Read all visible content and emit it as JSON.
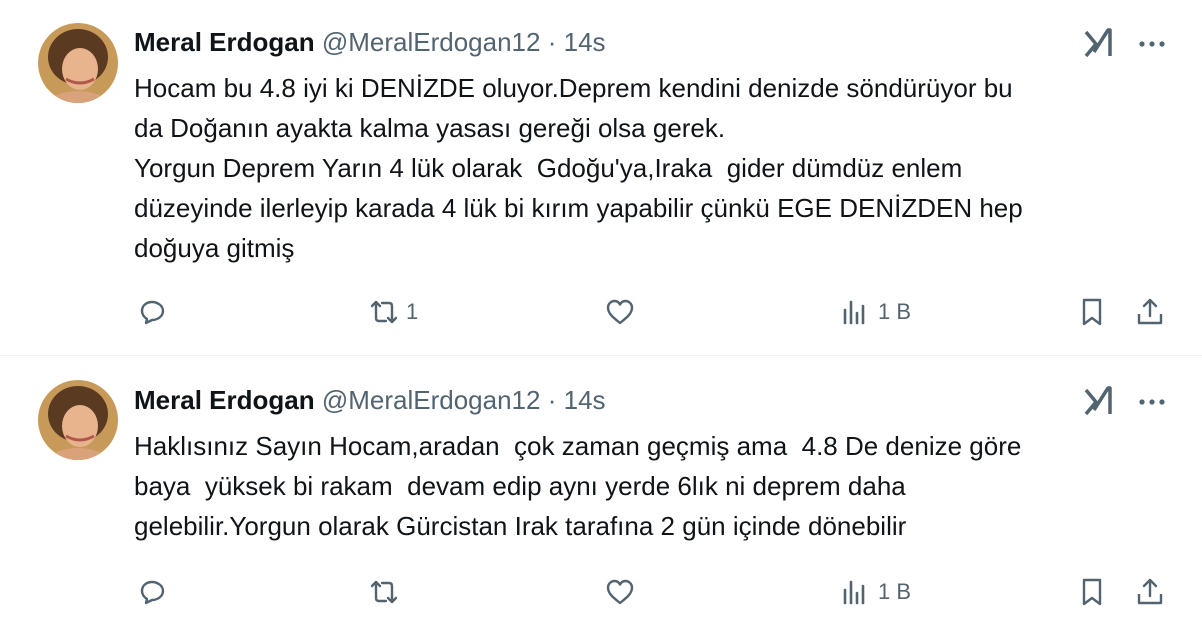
{
  "colors": {
    "text": "#0f1419",
    "secondary": "#536471",
    "divider": "#eff3f4"
  },
  "tweets": [
    {
      "name": "Meral Erdogan",
      "handle": "@MeralErdogan12",
      "separator": "·",
      "time": "14s",
      "text": "Hocam bu 4.8 iyi ki DENİZDE oluyor.Deprem kendini denizde söndürüyor bu\nda Doğanın ayakta kalma yasası gereği olsa gerek.\nYorgun Deprem Yarın 4 lük olarak  Gdoğu'ya,Iraka  gider dümdüz enlem\ndüzeyinde ilerleyip karada 4 lük bi kırım yapabilir çünkü EGE DENİZDEN hep\ndoğuya gitmiş",
      "retweets": "1",
      "views": "1 B"
    },
    {
      "name": "Meral Erdogan",
      "handle": "@MeralErdogan12",
      "separator": "·",
      "time": "14s",
      "text": "Haklısınız Sayın Hocam,aradan  çok zaman geçmiş ama  4.8 De denize göre\nbaya  yüksek bi rakam  devam edip aynı yerde 6lık ni deprem daha\ngelebilir.Yorgun olarak Gürcistan Irak tarafına 2 gün içinde dönebilir",
      "retweets": "",
      "views": "1 B"
    }
  ]
}
